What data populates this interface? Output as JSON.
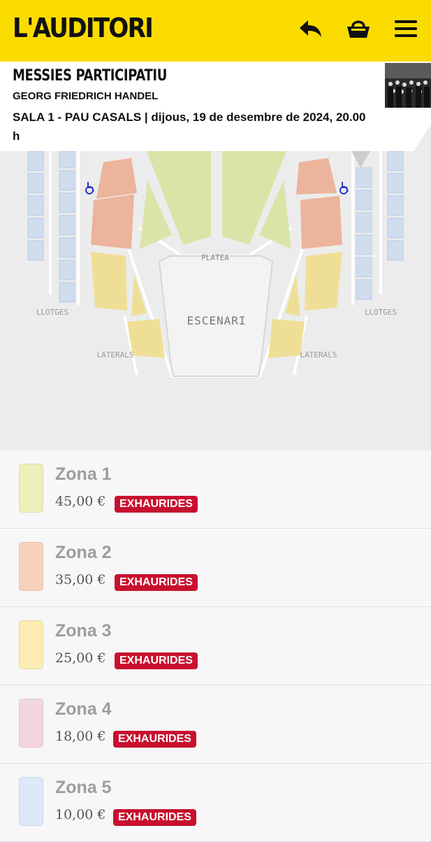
{
  "header": {
    "logo": "L'AUDITORI",
    "back_icon": "reply-arrow-icon",
    "basket_icon": "basket-icon",
    "menu_icon": "hamburger-menu-icon"
  },
  "event": {
    "title": "MESSIES PARTICIPATIU",
    "composer": "GEORG FRIEDRICH HANDEL",
    "venue_date": "SALA 1 - PAU CASALS | dijous, 19 de desembre de 2024, 20.00 h"
  },
  "seat_map": {
    "labels": {
      "platea": "PLATEA",
      "escenari": "ESCENARI",
      "llotges_left": "LLOTGES",
      "llotges_right": "LLOTGES",
      "laterals_left": "LATERALS",
      "laterals_right": "LATERALS"
    },
    "wheelchair_icon": "wheelchair-icon"
  },
  "zones": [
    {
      "name": "Zona 1",
      "price": "45,00 €",
      "status": "EXHAURIDES",
      "color": "#ecefb9"
    },
    {
      "name": "Zona 2",
      "price": "35,00 €",
      "status": "EXHAURIDES",
      "color": "#f9d1bb"
    },
    {
      "name": "Zona 3",
      "price": "25,00 €",
      "status": "EXHAURIDES",
      "color": "#fcecb4"
    },
    {
      "name": "Zona 4",
      "price": "18,00 €",
      "status": "EXHAURIDES",
      "color": "#f1d5e1"
    },
    {
      "name": "Zona 5",
      "price": "10,00 €",
      "status": "EXHAURIDES",
      "color": "#dde9f9"
    }
  ],
  "colors": {
    "header_bg": "#fbdc00",
    "badge_bg": "#c8102e"
  }
}
